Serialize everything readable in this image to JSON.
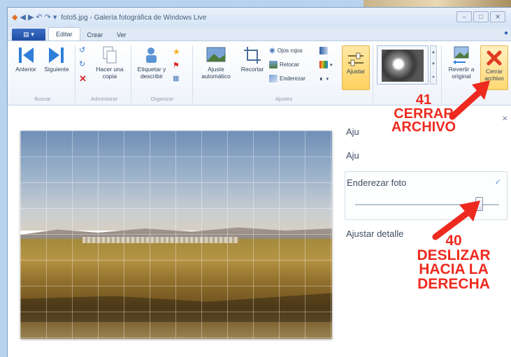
{
  "window": {
    "title": "foto5.jpg - Galería fotográfica de Windows Live",
    "controls": [
      "minimize",
      "maximize",
      "close"
    ]
  },
  "tabs": {
    "file_menu_icon": "menu-icon",
    "items": [
      {
        "label": "Editar",
        "active": true
      },
      {
        "label": "Crear",
        "active": false
      },
      {
        "label": "Ver",
        "active": false
      }
    ]
  },
  "ribbon": {
    "groups": {
      "browse": {
        "label": "Buscar",
        "anterior": "Anterior",
        "siguiente": "Siguiente"
      },
      "manage": {
        "label": "Administrar",
        "copy_line1": "Hacer una",
        "copy_line2": "copia"
      },
      "organize": {
        "label": "Organizar",
        "tag_line1": "Etiquetar y",
        "tag_line2": "describir"
      },
      "adjust": {
        "label": "Ajustes",
        "auto_line1": "Ajuste",
        "auto_line2": "automático",
        "crop": "Recortar",
        "red_eye": "Ojos rojos",
        "retouch": "Retocar",
        "straighten": "Enderezar",
        "adjust_button": "Ajustar"
      },
      "revert": {
        "line1": "Revertir a",
        "line2": "original"
      },
      "close_file": {
        "line1": "Cerrar",
        "line2": "archivo"
      }
    }
  },
  "side_panel": {
    "item1": "Aju",
    "item2": "Aju",
    "straighten_label": "Enderezar foto",
    "straighten_value": 0.86,
    "detail_label": "Ajustar detalle"
  },
  "annotations": {
    "close": {
      "number": "41",
      "line1": "CERRAR",
      "line2": "ARCHIVO"
    },
    "slide": {
      "number": "40",
      "line1": "DESLIZAR",
      "line2": "HACIA LA",
      "line3": "DERECHA"
    }
  },
  "colors": {
    "annotation_red": "#ee2a1f",
    "ribbon_highlight": "#ffd25e",
    "accent_blue": "#2d63b8"
  }
}
